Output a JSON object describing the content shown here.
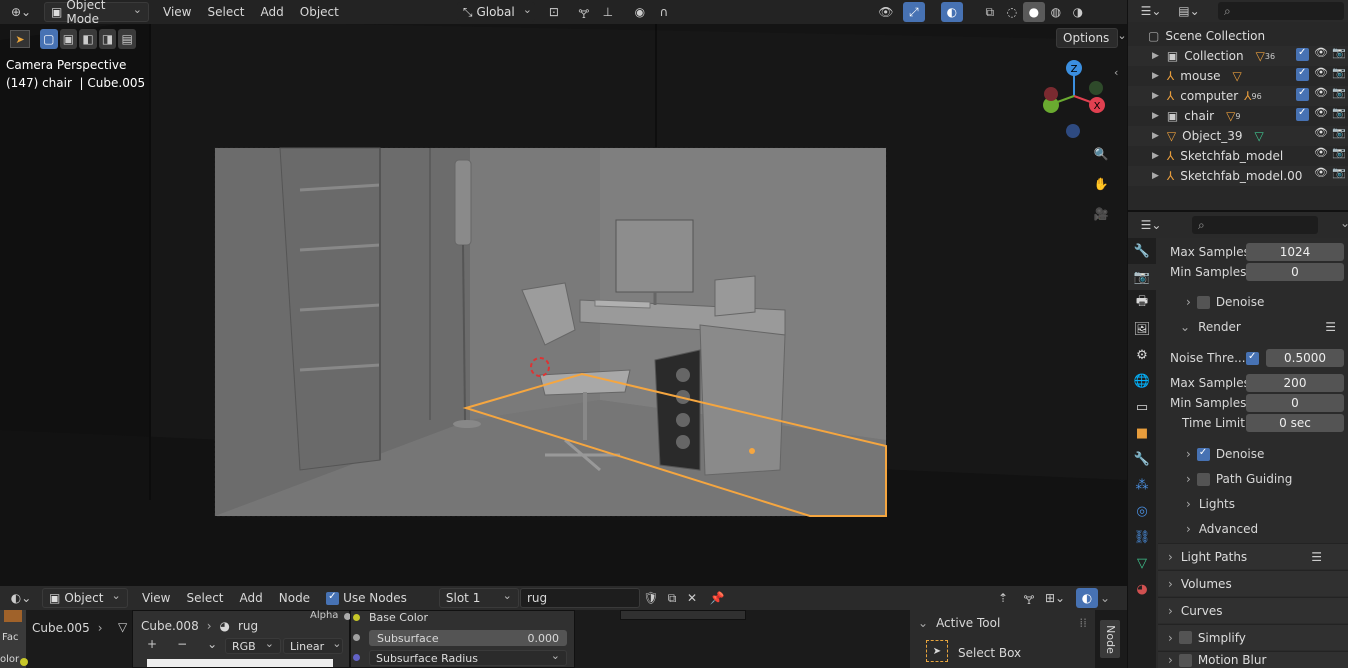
{
  "viewport": {
    "header": {
      "mode": "Object Mode",
      "menus": [
        "View",
        "Select",
        "Add",
        "Object"
      ],
      "orientation": "Global"
    },
    "options_label": "Options",
    "overlay_line1": "Camera Perspective",
    "overlay_line2": "(147) chair  | Cube.005",
    "gizmo": {
      "z": "Z",
      "x": "X"
    }
  },
  "outliner": {
    "root": "Scene Collection",
    "items": [
      {
        "label": "Collection",
        "badge": "36"
      },
      {
        "label": "mouse",
        "badge": ""
      },
      {
        "label": "computer",
        "badge": "96"
      },
      {
        "label": "chair",
        "badge": "9"
      },
      {
        "label": "Object_39",
        "badge": ""
      },
      {
        "label": "Sketchfab_model",
        "badge": ""
      },
      {
        "label": "Sketchfab_model.00",
        "badge": ""
      }
    ]
  },
  "properties": {
    "max_samples_label": "Max Samples",
    "max_samples_value": "1024",
    "min_samples_label": "Min Samples",
    "min_samples_value": "0",
    "denoise_label": "Denoise",
    "render_label": "Render",
    "noise_thresh_label": "Noise Thre...",
    "noise_thresh_value": "0.5000",
    "render_max_samples_label": "Max Samples",
    "render_max_samples_value": "200",
    "render_min_samples_label": "Min Samples",
    "render_min_samples_value": "0",
    "time_limit_label": "Time Limit",
    "time_limit_value": "0 sec",
    "render_denoise_label": "Denoise",
    "path_guiding_label": "Path Guiding",
    "lights_label": "Lights",
    "advanced_label": "Advanced",
    "light_paths_label": "Light Paths",
    "volumes_label": "Volumes",
    "curves_label": "Curves",
    "simplify_label": "Simplify",
    "motion_blur_label": "Motion Blur"
  },
  "node_editor": {
    "editor_type": "Object",
    "menus": [
      "View",
      "Select",
      "Add",
      "Node"
    ],
    "use_nodes_label": "Use Nodes",
    "slot": "Slot 1",
    "material": "rug",
    "breadcrumb": [
      "Cube.005",
      "Cube.008",
      "rug"
    ],
    "color_mode": "RGB",
    "interpolation": "Linear",
    "alpha_label": "Alpha",
    "base_color_label": "Base Color",
    "subsurface_label": "Subsurface",
    "subsurface_value": "0.000",
    "subsurface_radius_label": "Subsurface Radius",
    "fac_label": "Fac",
    "color_label": "olor",
    "active_tool_label": "Active Tool",
    "select_box_label": "Select Box",
    "node_tab": "Node"
  }
}
